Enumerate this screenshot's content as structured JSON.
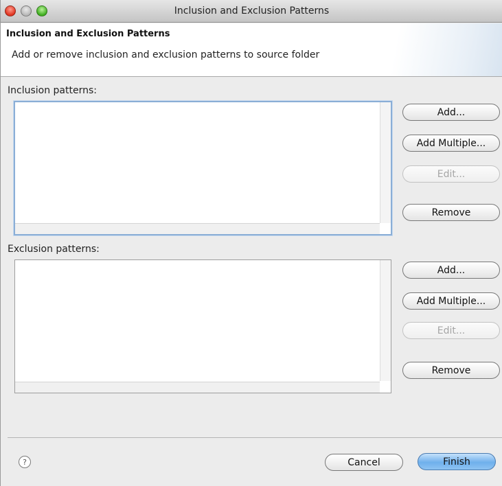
{
  "window": {
    "title": "Inclusion and Exclusion Patterns"
  },
  "header": {
    "title": "Inclusion and Exclusion Patterns",
    "description": "Add or remove inclusion and exclusion patterns to source folder"
  },
  "inclusion": {
    "label": "Inclusion patterns:",
    "items": [],
    "buttons": {
      "add": "Add...",
      "add_multiple": "Add Multiple...",
      "edit": "Edit...",
      "remove": "Remove"
    }
  },
  "exclusion": {
    "label": "Exclusion patterns:",
    "items": [],
    "buttons": {
      "add": "Add...",
      "add_multiple": "Add Multiple...",
      "edit": "Edit...",
      "remove": "Remove"
    }
  },
  "footer": {
    "help": "?",
    "cancel": "Cancel",
    "finish": "Finish"
  }
}
